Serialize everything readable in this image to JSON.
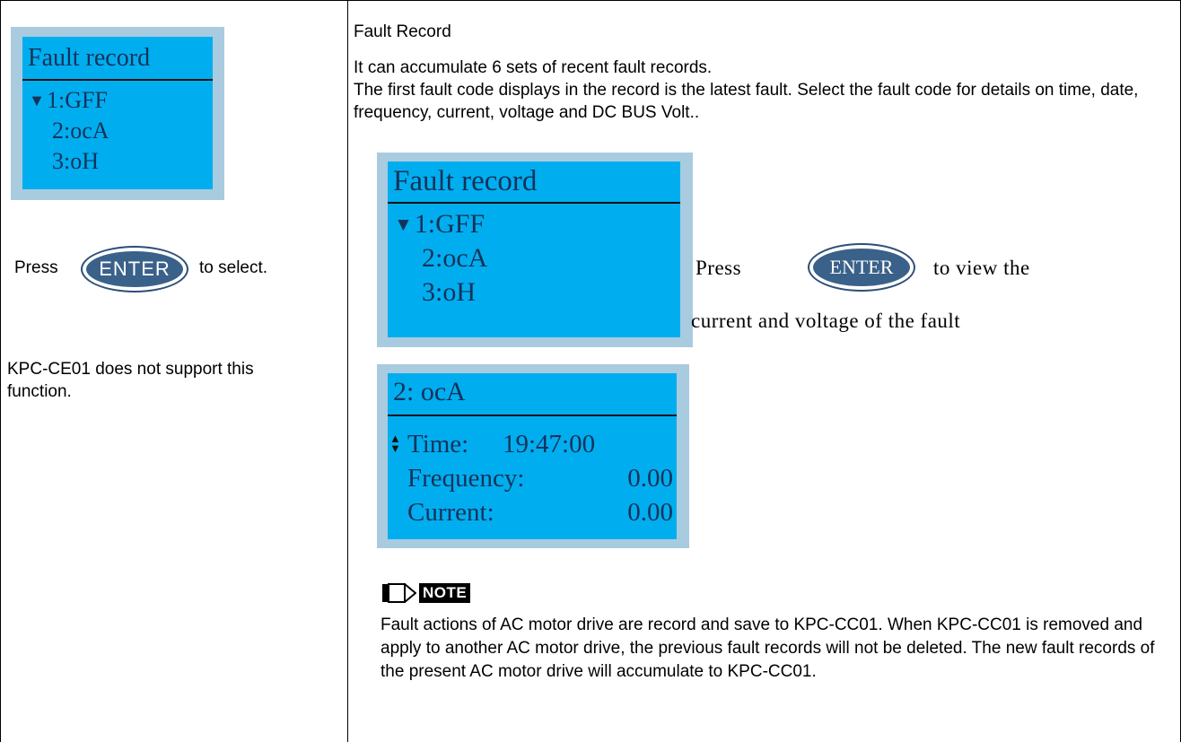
{
  "left": {
    "lcd": {
      "title": "Fault record",
      "items": [
        "1:GFF",
        "2:ocA",
        "3:oH"
      ]
    },
    "press_label": "Press",
    "enter_label": "ENTER",
    "select_label": "to select.",
    "unsupported": "KPC-CE01 does not support this function."
  },
  "right": {
    "heading": "Fault Record",
    "description": "It can accumulate 6 sets of recent fault records.\nThe first fault code displays in the record is the latest fault. Select the fault code for details on time, date, frequency, current, voltage and DC BUS Volt..",
    "lcd1": {
      "title": "Fault record",
      "items": [
        "1:GFF",
        "2:ocA",
        "3:oH"
      ]
    },
    "press_label": "Press",
    "enter_label": "ENTER",
    "view_label": "to view the",
    "view_label2": "current and voltage  of the fault",
    "lcd2": {
      "title": "2: ocA",
      "time_label": "Time:",
      "time_value": "19:47:00",
      "freq_label": "Frequency:",
      "freq_value": "0.00",
      "current_label": "Current:",
      "current_value": "0.00"
    },
    "note": {
      "label": "NOTE",
      "text": "Fault actions of AC motor drive are record and save to KPC-CC01. When KPC-CC01 is removed and apply to another AC motor drive, the previous fault records will not be deleted. The new fault records of the present AC motor drive will accumulate to KPC-CC01."
    }
  }
}
